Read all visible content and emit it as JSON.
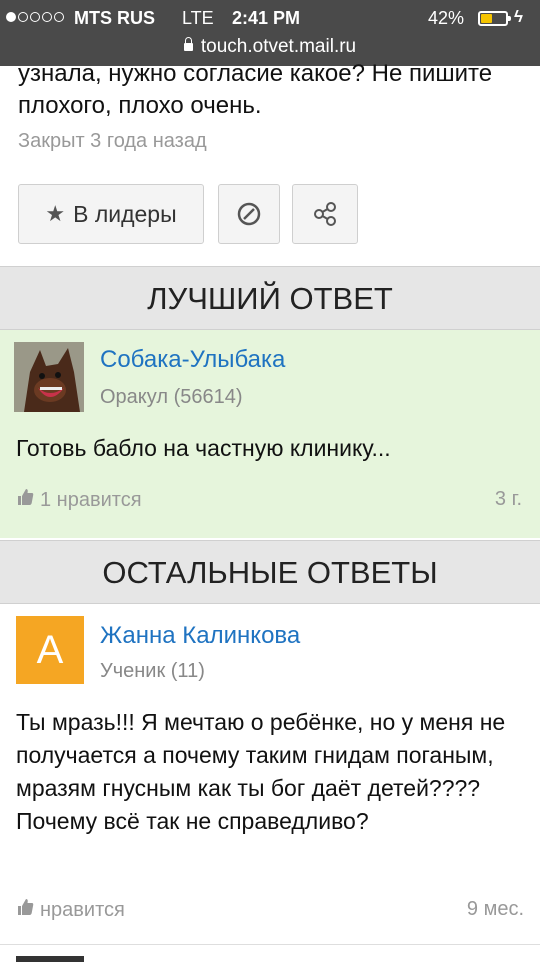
{
  "status_bar": {
    "carrier": "MTS RUS",
    "network": "LTE",
    "time": "2:41 PM",
    "battery": "42%",
    "battery_level": 0.42,
    "url": "touch.otvet.mail.ru"
  },
  "question": {
    "text": "узнала, нужно согласие какое? Не пишите плохого, плохо очень.",
    "closed": "Закрыт 3 года назад"
  },
  "actions": {
    "leaders_label": "В лидеры"
  },
  "best_answer": {
    "section_title": "ЛУЧШИЙ ОТВЕТ",
    "author": "Собака-Улыбака",
    "rank": "Оракул (56614)",
    "text": "Готовь бабло на частную клинику...",
    "likes": "1 нравится",
    "age": "3 г."
  },
  "other_answers": {
    "section_title": "ОСТАЛЬНЫЕ ОТВЕТЫ",
    "items": [
      {
        "avatar_letter": "А",
        "author": "Жанна Калинкова",
        "rank": "Ученик (11)",
        "text": "Ты мразь!!! Я мечтаю о ребёнке, но у меня не получается а почему таким гнидам поганым, мразям гнусным как ты бог даёт детей???? Почему всё так не справедливо?",
        "likes": "нравится",
        "age": "9 мес."
      }
    ]
  },
  "colors": {
    "link": "#1f73c1",
    "best_bg": "#e6f5dc",
    "avatar_a": "#f5a623",
    "status_bar": "#4a4a4a"
  }
}
